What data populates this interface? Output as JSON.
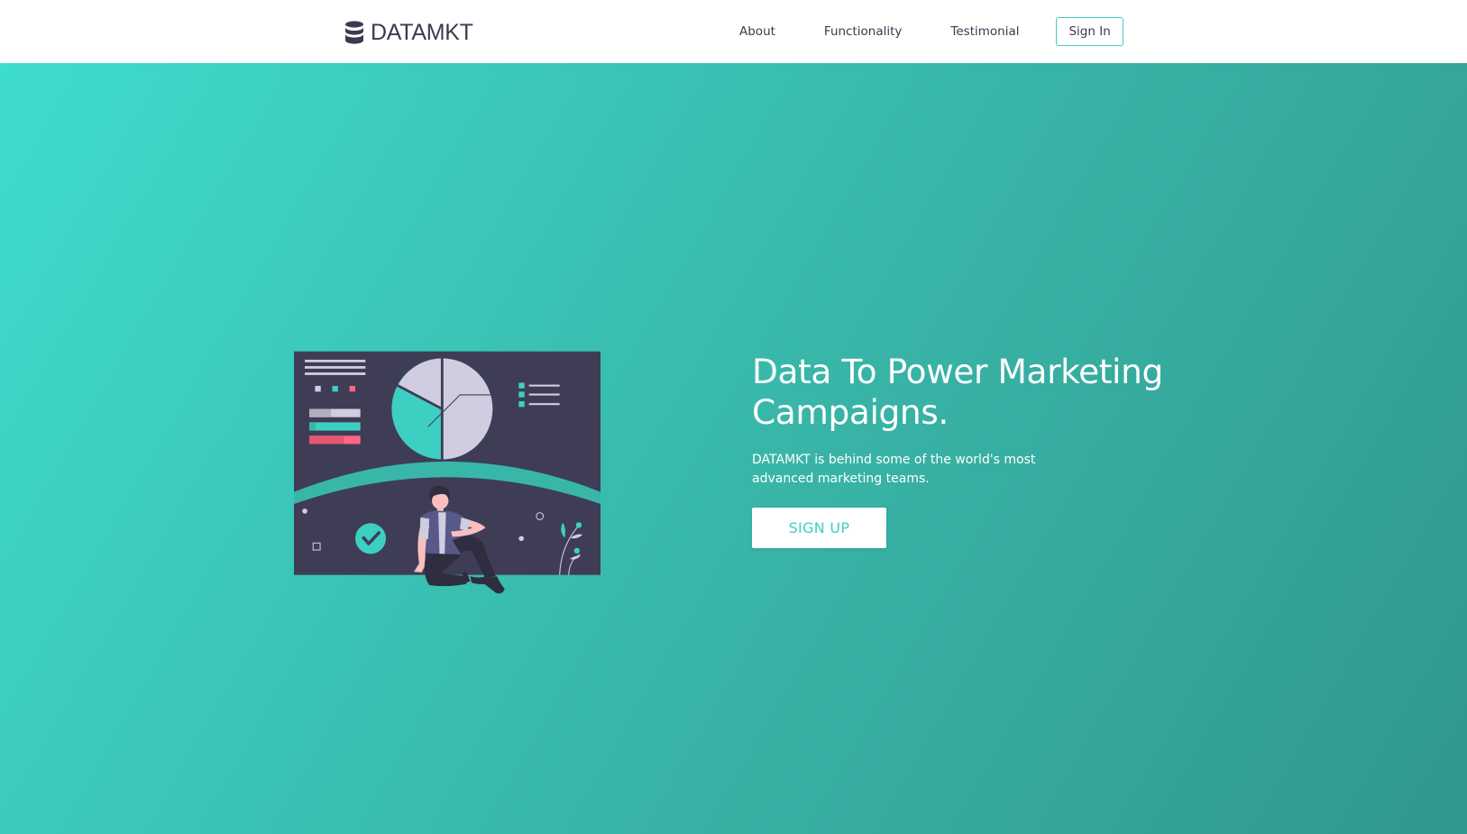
{
  "navbar": {
    "brand": {
      "icon": "database-icon",
      "name": "DATAMKT"
    },
    "links": [
      {
        "label": "About"
      },
      {
        "label": "Functionality"
      },
      {
        "label": "Testimonial"
      }
    ],
    "signin_label": "Sign In"
  },
  "hero": {
    "title": "Data To Power Marketing Campaigns.",
    "subtitle": "DATAMKT is behind some of the world's most advanced marketing teams.",
    "signup_label": "SIGN UP",
    "illustration": "analytics-dashboard-person-illustration"
  },
  "colors": {
    "accent": "#3dcfc2",
    "gradient_start": "#3edcce",
    "gradient_end": "#30988d",
    "dark": "#3b3a4f",
    "illustration_bg": "#3f3d56",
    "pink": "#ff6584",
    "light_lilac": "#d0cde1"
  }
}
